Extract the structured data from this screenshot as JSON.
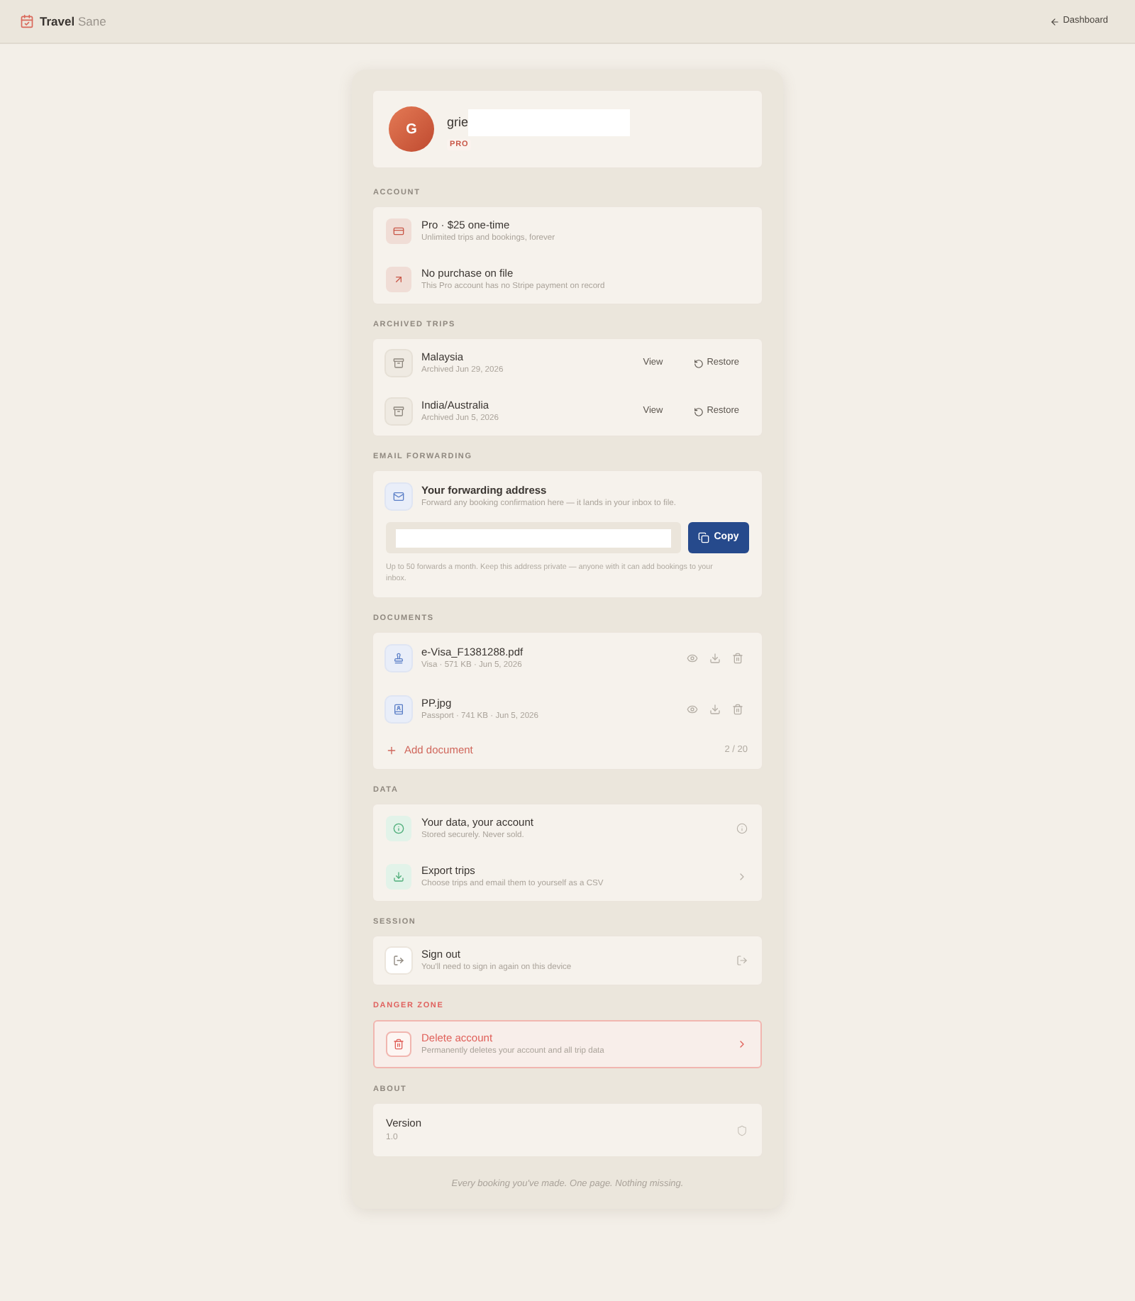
{
  "header": {
    "brand": "Travel",
    "brand_suffix": "Sane",
    "back_link": "Dashboard"
  },
  "profile": {
    "initial": "G",
    "name": "grie",
    "badge": "PRO"
  },
  "account": {
    "label": "ACCOUNT",
    "rows": [
      {
        "title": "Pro · $25 one-time",
        "subtitle": "Unlimited trips and bookings, forever"
      },
      {
        "title": "No purchase on file",
        "subtitle": "This Pro account has no Stripe payment on record"
      }
    ]
  },
  "archived_trips": {
    "label": "ARCHIVED TRIPS",
    "trips": [
      {
        "name": "Malaysia",
        "archived": "Archived Jun 29, 2026",
        "view": "View",
        "restore": "Restore"
      },
      {
        "name": "India/Australia",
        "archived": "Archived Jun 5, 2026",
        "view": "View",
        "restore": "Restore"
      }
    ]
  },
  "email_forwarding": {
    "label": "EMAIL FORWARDING",
    "title": "Your forwarding address",
    "subtitle": "Forward any booking confirmation here — it lands in your inbox to file.",
    "copy_button": "Copy",
    "note": "Up to 50 forwards a month. Keep this address private — anyone with it can add bookings to your inbox."
  },
  "documents": {
    "label": "DOCUMENTS",
    "files": [
      {
        "kind": "visa",
        "name": "e-Visa_F1381288.pdf",
        "meta": "Visa · 571 KB · Jun 5, 2026"
      },
      {
        "kind": "passport",
        "name": "PP.jpg",
        "meta": "Passport · 741 KB · Jun 5, 2026"
      }
    ],
    "add_button": "Add document",
    "count": "2 / 20"
  },
  "data": {
    "label": "DATA",
    "rows": [
      {
        "kind": "info",
        "title": "Your data, your account",
        "subtitle": "Stored securely. Never sold."
      },
      {
        "kind": "action",
        "title": "Export trips",
        "subtitle": "Choose trips and email them to yourself as a CSV"
      }
    ]
  },
  "session": {
    "label": "SESSION",
    "title": "Sign out",
    "subtitle": "You'll need to sign in again on this device"
  },
  "danger_zone": {
    "label": "DANGER ZONE",
    "title": "Delete account",
    "subtitle": "Permanently deletes your account and all trip data"
  },
  "about": {
    "label": "ABOUT",
    "title": "Version",
    "subtitle": "1.0"
  },
  "footer": "Every booking you've made. One page. Nothing missing."
}
